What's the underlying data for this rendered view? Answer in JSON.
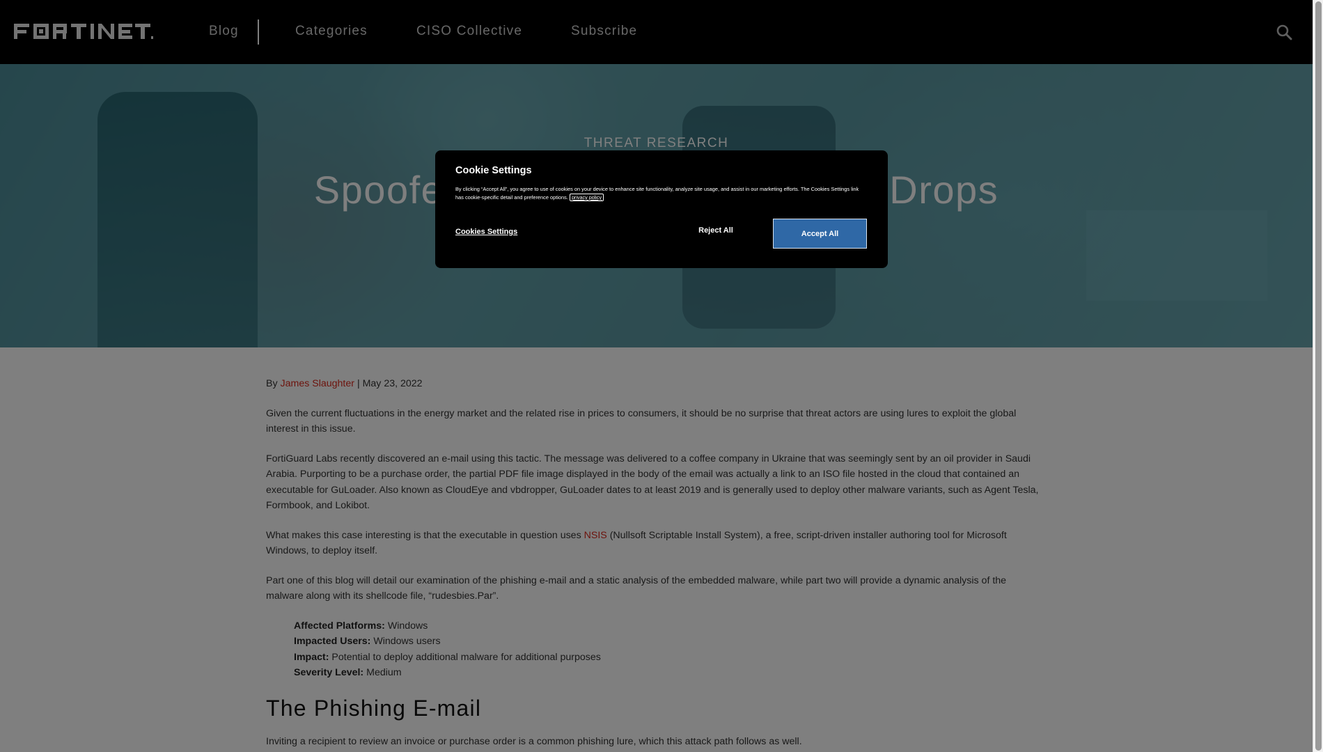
{
  "nav": {
    "logo_text": "FORTINET",
    "items": [
      {
        "label": "Blog"
      },
      {
        "label": "Categories"
      },
      {
        "label": "CISO Collective"
      },
      {
        "label": "Subscribe"
      }
    ],
    "search_icon": "search-icon"
  },
  "hero": {
    "kicker": "THREAT RESEARCH",
    "title_left": "Spoofe",
    "title_right": "Drops"
  },
  "article": {
    "byline_prefix": "By",
    "author": "James Slaughter",
    "separator": "|",
    "date": "May 23, 2022",
    "para1": "Given the current fluctuations in the energy market and the related rise in prices to consumers, it should be no surprise that threat actors are using lures to exploit the global interest in this issue.",
    "para2": "FortiGuard Labs recently discovered an e-mail using this tactic. The message was delivered to a coffee company in Ukraine that was seemingly sent by an oil provider in Saudi Arabia. Purporting to be a purchase order, the partial PDF file image displayed in the body of the email was actually a link to an ISO file hosted in the cloud that contained an executable for GuLoader. Also known as CloudEye and vbdropper, GuLoader dates to at least 2019 and is generally used to deploy other malware variants, such as Agent Tesla, Formbook, and Lokibot.",
    "para3_before": "What makes this case interesting is that the executable in question uses ",
    "para3_link": "NSIS",
    "para3_after": " (Nullsoft Scriptable Install System), a free, script-driven installer authoring tool for Microsoft Windows, to deploy itself.",
    "para4": "Part one of this blog will detail our examination of the phishing e-mail and a static analysis of the embedded malware, while part two will provide a dynamic analysis of the malware along with its shellcode file, “rudesbies.Par”.",
    "meta": [
      {
        "label": "Affected Platforms:",
        "value": "Windows"
      },
      {
        "label": "Impacted Users:",
        "value": "Windows users"
      },
      {
        "label": "Impact:",
        "value": "Potential to deploy additional malware for additional purposes"
      },
      {
        "label": "Severity Level:",
        "value": "Medium"
      }
    ],
    "section_heading": "The Phishing E-mail",
    "para5": "Inviting a recipient to review an invoice or purchase order is a common phishing lure, which this attack path follows as well."
  },
  "cookie_modal": {
    "title": "Cookie Settings",
    "text": "By clicking “Accept All”, you agree to use of cookies on your device to enhance site functionality, analyze site usage, and assist in our marketing efforts. The Cookies Settings link has cookie-specific detail and preference options.",
    "privacy_link": "privacy policy",
    "settings_link": "Cookies Settings",
    "reject_label": "Reject All",
    "accept_label": "Accept All",
    "accept_color": "#2f68a6"
  }
}
